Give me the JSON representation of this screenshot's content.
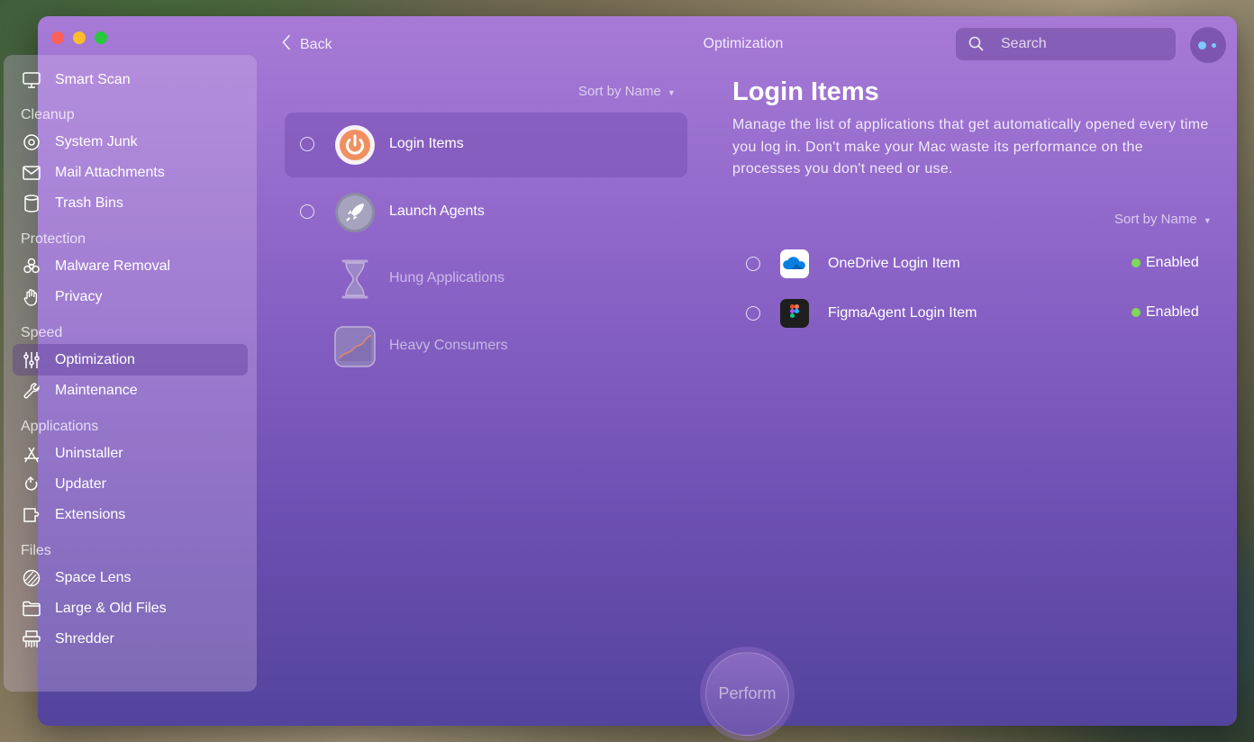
{
  "header": {
    "title": "Optimization",
    "back_label": "Back",
    "search_placeholder": "Search"
  },
  "sidebar": {
    "smart_scan": "Smart Scan",
    "sections": {
      "cleanup": "Cleanup",
      "protection": "Protection",
      "speed": "Speed",
      "applications": "Applications",
      "files": "Files"
    },
    "items": {
      "system_junk": "System Junk",
      "mail_attachments": "Mail Attachments",
      "trash_bins": "Trash Bins",
      "malware_removal": "Malware Removal",
      "privacy": "Privacy",
      "optimization": "Optimization",
      "maintenance": "Maintenance",
      "uninstaller": "Uninstaller",
      "updater": "Updater",
      "extensions": "Extensions",
      "space_lens": "Space Lens",
      "large_old_files": "Large & Old Files",
      "shredder": "Shredder"
    }
  },
  "modules": {
    "sort_label": "Sort by Name",
    "items": [
      {
        "label": "Login Items"
      },
      {
        "label": "Launch Agents"
      },
      {
        "label": "Hung Applications"
      },
      {
        "label": "Heavy Consumers"
      }
    ]
  },
  "detail": {
    "title": "Login Items",
    "description": "Manage the list of applications that get automatically opened every time you log in. Don't make your Mac waste its performance on the processes you don't need or use.",
    "sort_label": "Sort by Name",
    "items": [
      {
        "label": "OneDrive Login Item",
        "status": "Enabled"
      },
      {
        "label": "FigmaAgent Login Item",
        "status": "Enabled"
      }
    ]
  },
  "perform_label": "Perform",
  "colors": {
    "status_green": "#7ed957",
    "login_icon_orange": "#e8703a"
  }
}
